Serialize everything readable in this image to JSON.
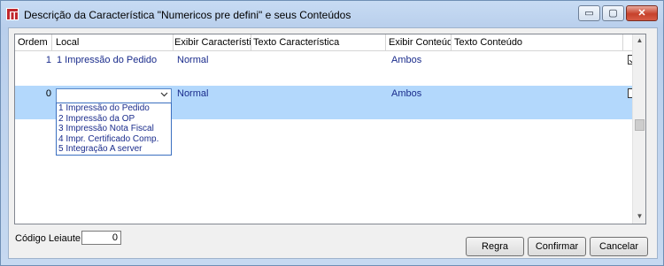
{
  "window": {
    "title": "Descrição da Característica \"Numericos pre defini\" e seus Conteúdos",
    "controls": {
      "minimize": "▭",
      "maximize": "▢",
      "close": "✕"
    }
  },
  "grid": {
    "columns": [
      "Ordem",
      "Local",
      "Exibir Característica",
      "Texto Característica",
      "Exibir Conteúdo",
      "Texto Conteúdo"
    ],
    "rows": [
      {
        "ordem": "1",
        "local": "1 Impressão do Pedido",
        "exibir_caracteristica": "Normal",
        "texto_caracteristica": "",
        "exibir_conteudo": "Ambos",
        "texto_conteudo": "",
        "checked": true
      },
      {
        "ordem": "0",
        "local": "",
        "exibir_caracteristica": "Normal",
        "texto_caracteristica": "",
        "exibir_conteudo": "Ambos",
        "texto_conteudo": "",
        "checked": false
      }
    ],
    "local_options": [
      "1 Impressão do Pedido",
      "2 Impressão da OP",
      "3 Impressão Nota Fiscal",
      "4 Impr. Certificado Comp.",
      "5 Integração A server"
    ]
  },
  "footer": {
    "codigo_label": "Código Leiaute",
    "codigo_value": "0",
    "buttons": {
      "regra": "Regra",
      "confirmar": "Confirmar",
      "cancelar": "Cancelar"
    }
  },
  "colors": {
    "selected_row": "#b3d8fc",
    "value_text": "#1a2c8c",
    "title_bar": "#c7dbf3"
  },
  "icons": {
    "app": "app-logo-icon",
    "dropdown": "chevron-down-icon"
  }
}
